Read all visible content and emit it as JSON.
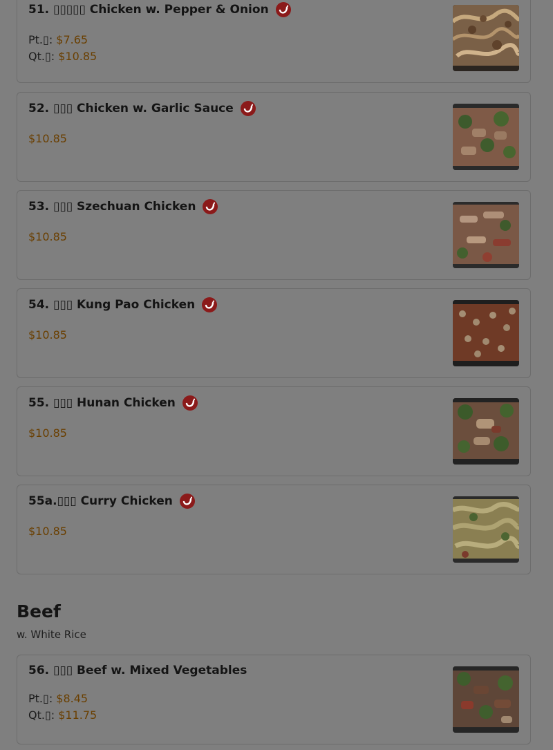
{
  "items": [
    {
      "title": "51. ▯▯▯▯▯ Chicken w. Pepper & Onion",
      "spicy": true,
      "prices": [
        {
          "label": "Pt.▯: ",
          "value": "$7.65"
        },
        {
          "label": "Qt.▯: ",
          "value": "$10.85"
        }
      ]
    },
    {
      "title": "52. ▯▯▯ Chicken w. Garlic Sauce",
      "spicy": true,
      "prices": [
        {
          "label": "",
          "value": "$10.85"
        }
      ]
    },
    {
      "title": "53. ▯▯▯ Szechuan Chicken",
      "spicy": true,
      "prices": [
        {
          "label": "",
          "value": "$10.85"
        }
      ]
    },
    {
      "title": "54. ▯▯▯ Kung Pao Chicken",
      "spicy": true,
      "prices": [
        {
          "label": "",
          "value": "$10.85"
        }
      ]
    },
    {
      "title": "55. ▯▯▯ Hunan Chicken",
      "spicy": true,
      "prices": [
        {
          "label": "",
          "value": "$10.85"
        }
      ]
    },
    {
      "title": "55a.▯▯▯ Curry Chicken",
      "spicy": true,
      "prices": [
        {
          "label": "",
          "value": "$10.85"
        }
      ]
    },
    {
      "title": "56. ▯▯▯ Beef w. Mixed Vegetables",
      "spicy": false,
      "prices": [
        {
          "label": "Pt.▯: ",
          "value": "$8.45"
        },
        {
          "label": "Qt.▯: ",
          "value": "$11.75"
        }
      ]
    }
  ],
  "beef_section": {
    "title": "Beef",
    "subtitle": "w. White Rice"
  },
  "colors": {
    "overlay": "#7f7f7f",
    "price": "#6a3f00",
    "spicy_icon": "#8b1a1a"
  },
  "icons": {
    "spicy": "chili-pepper-icon"
  }
}
